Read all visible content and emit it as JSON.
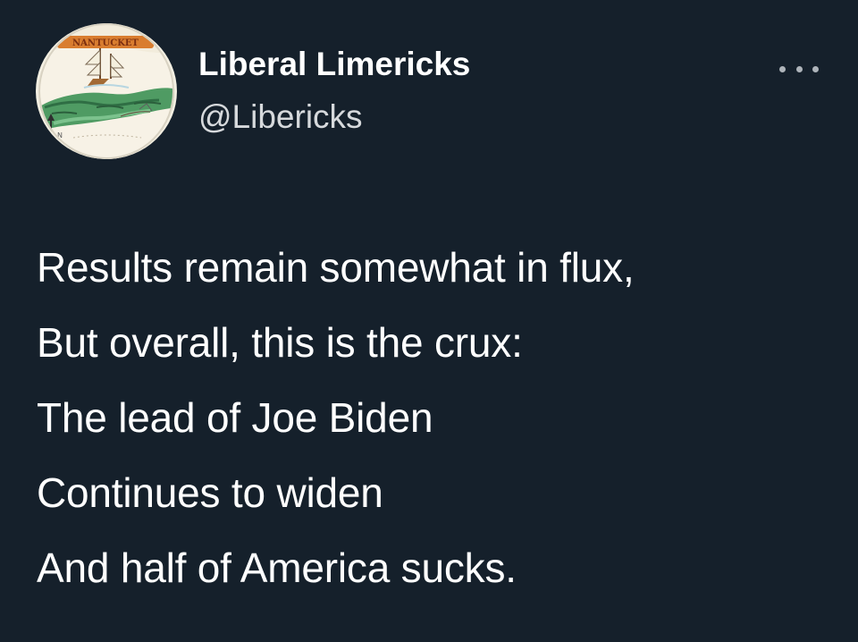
{
  "header": {
    "display_name": "Liberal Limericks",
    "handle": "@Libericks"
  },
  "avatar": {
    "icon": "map-avatar-icon",
    "banner_text": "NANTUCKET"
  },
  "menu": {
    "icon": "more-options-icon"
  },
  "poem": {
    "lines": [
      "Results remain somewhat in flux,",
      "But overall, this is the crux:",
      "The lead of Joe Biden",
      "Continues to widen",
      "And half of America sucks."
    ]
  },
  "colors": {
    "background": "#15202b",
    "text": "#ffffff",
    "handle": "#d6d9dc",
    "icon": "#aeb4ba"
  }
}
